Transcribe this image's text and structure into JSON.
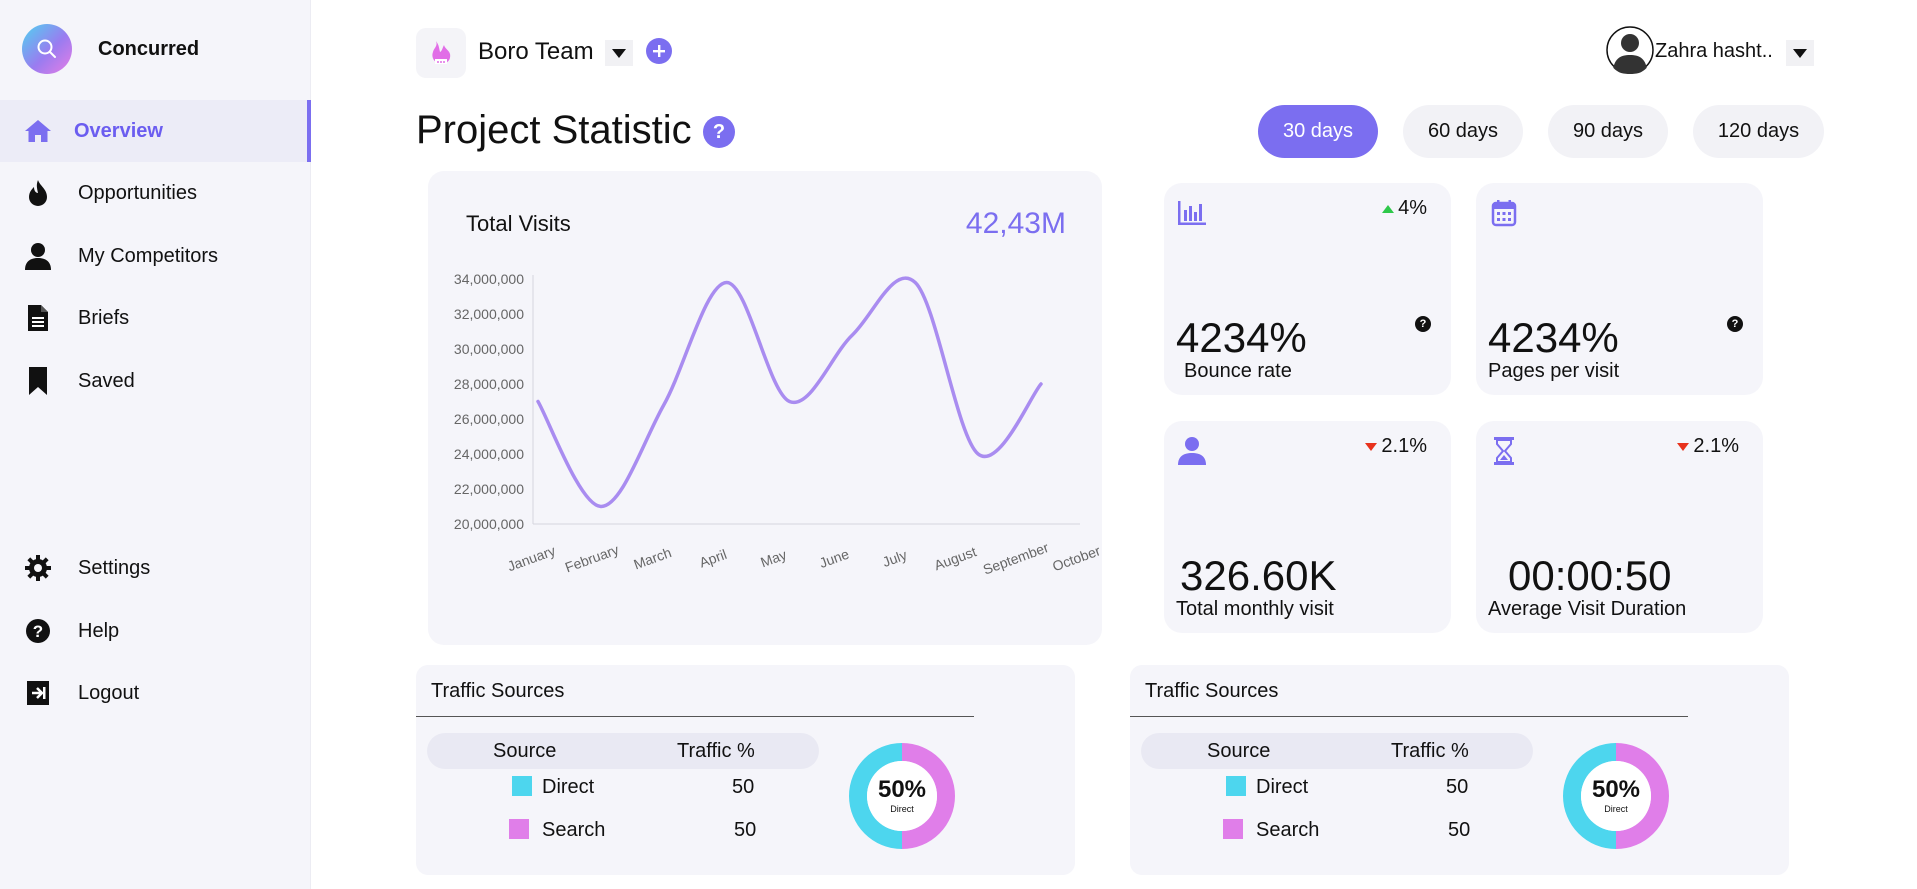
{
  "app": {
    "brand": "Concurred"
  },
  "sidebar": {
    "items": [
      {
        "label": "Overview",
        "icon": "home-icon",
        "active": true
      },
      {
        "label": "Opportunities",
        "icon": "fire-icon"
      },
      {
        "label": "My Competitors",
        "icon": "user-icon"
      },
      {
        "label": "Briefs",
        "icon": "document-icon"
      },
      {
        "label": "Saved",
        "icon": "bookmark-icon"
      }
    ],
    "bottom_items": [
      {
        "label": "Settings",
        "icon": "gear-icon"
      },
      {
        "label": "Help",
        "icon": "help-icon"
      },
      {
        "label": "Logout",
        "icon": "logout-icon"
      }
    ]
  },
  "header": {
    "team_name": "Boro Team",
    "user_name": "Zahra hasht..",
    "page_title": "Project Statistic",
    "help_label": "?"
  },
  "ranges": [
    {
      "label": "30 days",
      "active": true
    },
    {
      "label": "60 days"
    },
    {
      "label": "90 days"
    },
    {
      "label": "120 days"
    }
  ],
  "visits": {
    "title": "Total Visits",
    "value": "42,43M"
  },
  "chart_data": {
    "type": "line",
    "categories": [
      "January",
      "February",
      "March",
      "April",
      "May",
      "June",
      "July",
      "August",
      "September",
      "October"
    ],
    "series": [
      {
        "values": [
          27000000,
          21000000,
          26800000,
          33800000,
          27000000,
          30800000,
          33800000,
          24000000,
          28000000,
          null
        ]
      }
    ],
    "ylim": [
      20000000,
      34000000
    ],
    "yticks": [
      "34,000,000",
      "32,000,000",
      "30,000,000",
      "28,000,000",
      "26,000,000",
      "24,000,000",
      "22,000,000",
      "20,000,000"
    ],
    "line_color": "#a98cf0"
  },
  "stats": [
    {
      "icon": "bar-chart-icon",
      "delta": "4%",
      "trend": "up",
      "value": "4234%",
      "label": "Bounce rate",
      "help": "?"
    },
    {
      "icon": "calendar-icon",
      "delta": "",
      "trend": "",
      "value": "4234%",
      "label": "Pages per visit",
      "help": "?"
    },
    {
      "icon": "user-icon",
      "delta": "2.1%",
      "trend": "down",
      "value": "326.60K",
      "label": "Total monthly visit"
    },
    {
      "icon": "hourglass-icon",
      "delta": "2.1%",
      "trend": "down",
      "value": "00:00:50",
      "label": "Average Visit Duration"
    }
  ],
  "traffic": [
    {
      "title": "Traffic Sources",
      "col_source": "Source",
      "col_traffic": "Traffic %",
      "rows": [
        {
          "source": "Direct",
          "value": "50",
          "color": "#4dd6ee"
        },
        {
          "source": "Search",
          "value": "50",
          "color": "#e07ee9"
        }
      ],
      "donut_pct": "50%",
      "donut_label": "Direct",
      "split": 0.5
    },
    {
      "title": "Traffic Sources",
      "col_source": "Source",
      "col_traffic": "Traffic %",
      "rows": [
        {
          "source": "Direct",
          "value": "50",
          "color": "#4dd6ee"
        },
        {
          "source": "Search",
          "value": "50",
          "color": "#e07ee9"
        }
      ],
      "donut_pct": "50%",
      "donut_label": "Direct",
      "split": 0.5
    }
  ],
  "colors": {
    "accent": "#7b6ef0",
    "card_bg": "#f5f5fa",
    "up": "#2ec84a",
    "down": "#e8321d"
  }
}
